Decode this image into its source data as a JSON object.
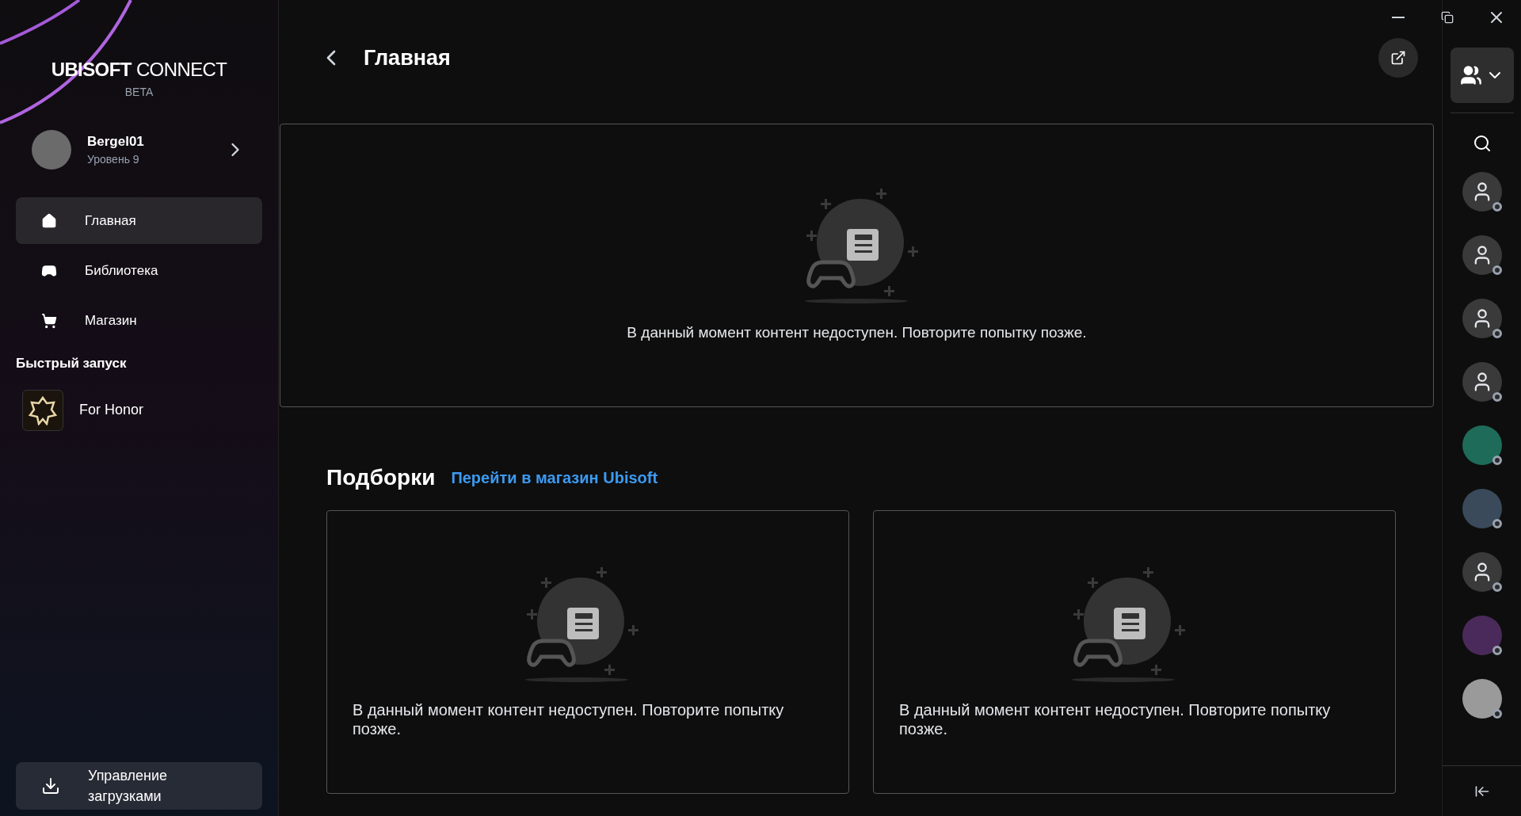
{
  "brand": {
    "name_bold": "UBISOFT",
    "name_light": "CONNECT",
    "tag": "BETA"
  },
  "profile": {
    "username": "Bergel01",
    "level": "Уровень 9"
  },
  "nav": [
    {
      "kind": "home",
      "label": "Главная",
      "selected": true
    },
    {
      "kind": "library",
      "label": "Библиотека",
      "selected": false
    },
    {
      "kind": "store",
      "label": "Магазин",
      "selected": false
    }
  ],
  "quick_launch": {
    "title": "Быстрый запуск",
    "games": [
      {
        "name": "For Honor"
      }
    ]
  },
  "downloads_button": {
    "label": "Управление загрузками"
  },
  "header": {
    "title": "Главная"
  },
  "hero_card": {
    "message": "В данный момент контент недоступен. Повторите попытку позже."
  },
  "collections": {
    "title": "Подборки",
    "link": "Перейти в магазин Ubisoft",
    "cards": [
      {
        "message": "В данный момент контент недоступен. Повторите попытку позже."
      },
      {
        "message": "В данный момент контент недоступен. Повторите попытку позже."
      }
    ]
  },
  "friends": [
    {
      "kind": "default"
    },
    {
      "kind": "default"
    },
    {
      "kind": "default"
    },
    {
      "kind": "default"
    },
    {
      "kind": "photo",
      "color": "#1e6b5a"
    },
    {
      "kind": "photo",
      "color": "#3a4a5a"
    },
    {
      "kind": "default"
    },
    {
      "kind": "photo",
      "color": "#4a2a5a"
    },
    {
      "kind": "photo",
      "color": "#9a9a9a"
    }
  ]
}
